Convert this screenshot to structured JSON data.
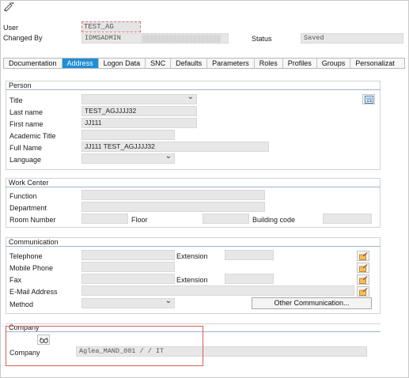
{
  "header": {
    "user_label": "User",
    "user_value": "TEST_AG",
    "changed_by_label": "Changed By",
    "changed_by_value": "IDMSADMIN",
    "status_label": "Status",
    "status_value": "Saved"
  },
  "tabs": [
    {
      "label": "Documentation",
      "active": false
    },
    {
      "label": "Address",
      "active": true
    },
    {
      "label": "Logon Data",
      "active": false
    },
    {
      "label": "SNC",
      "active": false
    },
    {
      "label": "Defaults",
      "active": false
    },
    {
      "label": "Parameters",
      "active": false
    },
    {
      "label": "Roles",
      "active": false
    },
    {
      "label": "Profiles",
      "active": false
    },
    {
      "label": "Groups",
      "active": false
    },
    {
      "label": "Personalizat",
      "active": false
    }
  ],
  "person": {
    "title": "Person",
    "title_label": "Title",
    "last_name_label": "Last name",
    "last_name_value": "TEST_AGJJJJ32",
    "first_name_label": "First name",
    "first_name_value": "JJ111",
    "academic_title_label": "Academic Title",
    "full_name_label": "Full Name",
    "full_name_value": "JJ111 TEST_AGJJJJ32",
    "language_label": "Language"
  },
  "work_center": {
    "title": "Work Center",
    "function_label": "Function",
    "department_label": "Department",
    "room_number_label": "Room Number",
    "floor_label": "Floor",
    "building_code_label": "Building code"
  },
  "communication": {
    "title": "Communication",
    "telephone_label": "Telephone",
    "extension_label": "Extension",
    "mobile_phone_label": "Mobile Phone",
    "fax_label": "Fax",
    "fax_extension_label": "Extension",
    "email_label": "E-Mail Address",
    "method_label": "Method",
    "other_comm_button": "Other Communication..."
  },
  "company": {
    "title": "Company",
    "company_label": "Company",
    "company_value": "Aglea_MAND_001 /    / IT"
  },
  "icons": {
    "top": "display-change-icon",
    "person_side": "picture-icon",
    "comm": "edit-icon",
    "company": "glasses-icon"
  },
  "colors": {
    "active_tab": "#1f8fd3",
    "highlight_box": "#d85c5c",
    "field_bg": "#e7e7e7"
  }
}
